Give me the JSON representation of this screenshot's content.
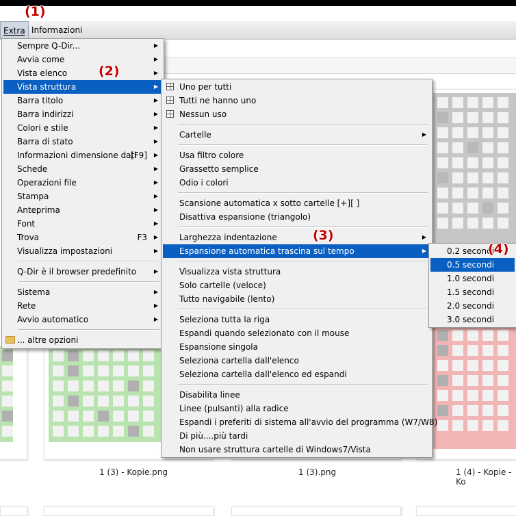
{
  "menubar": {
    "extra": "Extra",
    "informazioni": "Informazioni"
  },
  "markers": [
    "(1)",
    "(2)",
    "(3)",
    "(4)"
  ],
  "captions": [
    "1 (3) - Kopie.png",
    "1 (3).png",
    "1 (4) - Kopie - Ko"
  ],
  "menu1": [
    {
      "label": "Sempre Q-Dir...",
      "sub": true
    },
    {
      "label": "Avvia come",
      "sub": true
    },
    {
      "label": "Vista elenco",
      "sub": true
    },
    {
      "label": "Vista struttura",
      "sub": true,
      "hl": true
    },
    {
      "label": "Barra titolo",
      "sub": true
    },
    {
      "label": "Barra indirizzi",
      "sub": true
    },
    {
      "label": "Colori e stile",
      "sub": true
    },
    {
      "label": "Barra di stato",
      "sub": true
    },
    {
      "label": "Informazioni dimensione dati",
      "shortcut": "[F9]",
      "sub": true
    },
    {
      "label": "Schede",
      "sub": true
    },
    {
      "label": "Operazioni file",
      "sub": true
    },
    {
      "label": "Stampa",
      "sub": true
    },
    {
      "label": "Anteprima",
      "sub": true
    },
    {
      "label": "Font",
      "sub": true
    },
    {
      "label": "Trova",
      "shortcut": "F3",
      "sub": true
    },
    {
      "label": "Visualizza impostazioni",
      "sub": true
    },
    {
      "sep": true
    },
    {
      "label": "Q-Dir è il browser predefinito",
      "sub": true
    },
    {
      "sep": true
    },
    {
      "label": "Sistema",
      "sub": true
    },
    {
      "label": "Rete",
      "sub": true
    },
    {
      "label": "Avvio automatico",
      "sub": true
    },
    {
      "sep": true
    },
    {
      "label": "... altre opzioni",
      "icon": "folder-icon"
    }
  ],
  "menu2": [
    {
      "label": "Uno per tutti",
      "icon": "grid-icon"
    },
    {
      "label": "Tutti ne hanno uno",
      "icon": "grid-icon"
    },
    {
      "label": "Nessun uso",
      "icon": "grid-icon"
    },
    {
      "sep": true
    },
    {
      "label": "Cartelle",
      "sub": true
    },
    {
      "sep": true
    },
    {
      "label": "Usa filtro colore"
    },
    {
      "label": "Grassetto semplice"
    },
    {
      "label": "Odio i colori"
    },
    {
      "sep": true
    },
    {
      "label": "Scansione automatica x sotto cartelle [+][ ]"
    },
    {
      "label": "Disattiva espansione (triangolo)"
    },
    {
      "sep": true
    },
    {
      "label": "Larghezza indentazione",
      "sub": true
    },
    {
      "label": "Espansione automatica trascina sul tempo",
      "sub": true,
      "hl": true
    },
    {
      "sep": true
    },
    {
      "label": "Visualizza vista struttura"
    },
    {
      "label": "Solo cartelle (veloce)"
    },
    {
      "label": "Tutto navigabile (lento)"
    },
    {
      "sep": true
    },
    {
      "label": "Seleziona tutta la riga"
    },
    {
      "label": "Espandi quando selezionato con il mouse"
    },
    {
      "label": "Espansione singola"
    },
    {
      "label": "Seleziona cartella dall'elenco"
    },
    {
      "label": "Seleziona cartella dall'elenco ed espandi"
    },
    {
      "sep": true
    },
    {
      "label": "Disabilita linee"
    },
    {
      "label": "Linee (pulsanti) alla radice"
    },
    {
      "label": "Espandi i preferiti di sistema all'avvio del programma (W7/W8)"
    },
    {
      "label": "Di più....più tardi"
    },
    {
      "label": "Non usare struttura cartelle di Windows7/Vista"
    }
  ],
  "menu3": [
    {
      "label": "0.2 secondi"
    },
    {
      "label": "0.5 secondi",
      "hl": true
    },
    {
      "label": "1.0 secondi"
    },
    {
      "label": "1.5 secondi"
    },
    {
      "label": "2.0 secondi"
    },
    {
      "label": "3.0 secondi"
    }
  ],
  "colors": {
    "highlight": "#0a5fc2",
    "marker": "#c00000",
    "green": "#b9e4b0",
    "pink": "#f2b5b5",
    "gray": "#c6c6c6"
  }
}
